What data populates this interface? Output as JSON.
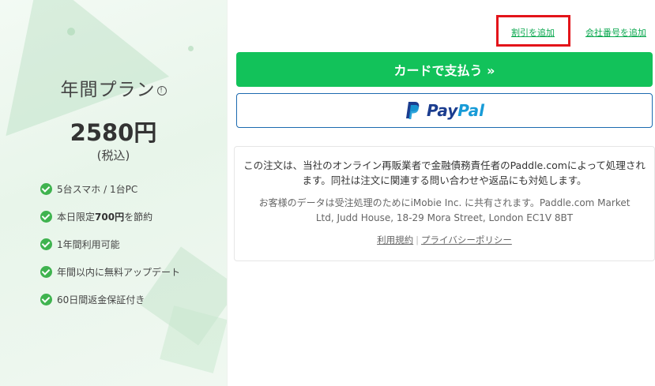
{
  "plan": {
    "title": "年間プラン",
    "info_icon": "info-icon",
    "price": "2580円",
    "tax_note": "(税込)",
    "features": [
      {
        "pre": "5台スマホ / 1台PC",
        "bold": "",
        "post": ""
      },
      {
        "pre": "本日限定",
        "bold": "700円",
        "post": "を節約"
      },
      {
        "pre": "1年間利用可能",
        "bold": "",
        "post": ""
      },
      {
        "pre": "年間以内に無料アップデート",
        "bold": "",
        "post": ""
      },
      {
        "pre": "60日間返金保証付き",
        "bold": "",
        "post": ""
      }
    ]
  },
  "payment": {
    "discount_link": "割引を追加",
    "company_number_link": "会社番号を追加",
    "card_button": "カードで支払う »",
    "paypal_pay": "Pay",
    "paypal_pal": "Pal"
  },
  "notice": {
    "main_text": "この注文は、当社のオンライン再販業者で金融債務責任者のPaddle.comによって処理されます。同社は注文に関連する問い合わせや返品にも対処します。",
    "sub_text": "お客様のデータは受注処理のためにiMobie Inc. に共有されます。Paddle.com Market Ltd, Judd House, 18-29 Mora Street, London EC1V 8BT",
    "terms_link": "利用規約",
    "separator": "|",
    "privacy_link": "プライバシーポリシー"
  },
  "colors": {
    "brand_green": "#12c25a",
    "link_green": "#0aa84f",
    "highlight_red": "#e3141a",
    "paypal_dark": "#1b3d8f",
    "paypal_light": "#179bd7"
  }
}
